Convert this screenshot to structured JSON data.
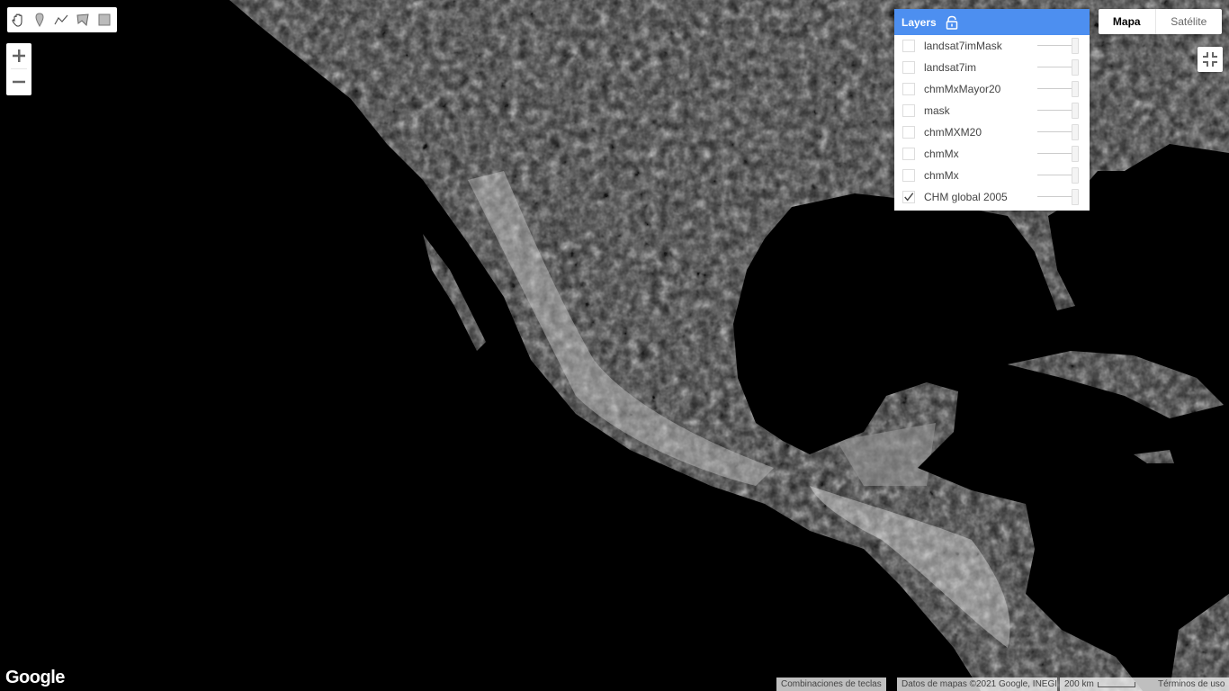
{
  "toolbar": {
    "tools": [
      "pan-hand-icon",
      "marker-pin-icon",
      "polyline-icon",
      "polygon-icon",
      "rectangle-icon"
    ]
  },
  "zoom": {
    "in_label": "+",
    "out_label": "−"
  },
  "layers_panel": {
    "title": "Layers",
    "accent_color": "#4d8ff0",
    "items": [
      {
        "label": "landsat7imMask",
        "checked": false
      },
      {
        "label": "landsat7im",
        "checked": false
      },
      {
        "label": "chmMxMayor20",
        "checked": false
      },
      {
        "label": "mask",
        "checked": false
      },
      {
        "label": "chmMXM20",
        "checked": false
      },
      {
        "label": "chmMx",
        "checked": false
      },
      {
        "label": "chmMx",
        "checked": false
      },
      {
        "label": "CHM global 2005",
        "checked": true
      }
    ]
  },
  "map_type": {
    "map_label": "Mapa",
    "satellite_label": "Satélite",
    "selected": "Mapa"
  },
  "logo": {
    "text": "Google"
  },
  "footer": {
    "shortcuts": "Combinaciones de teclas",
    "map_data": "Datos de mapas ©2021 Google, INEGI",
    "scale": "200 km",
    "terms": "Términos de uso"
  }
}
